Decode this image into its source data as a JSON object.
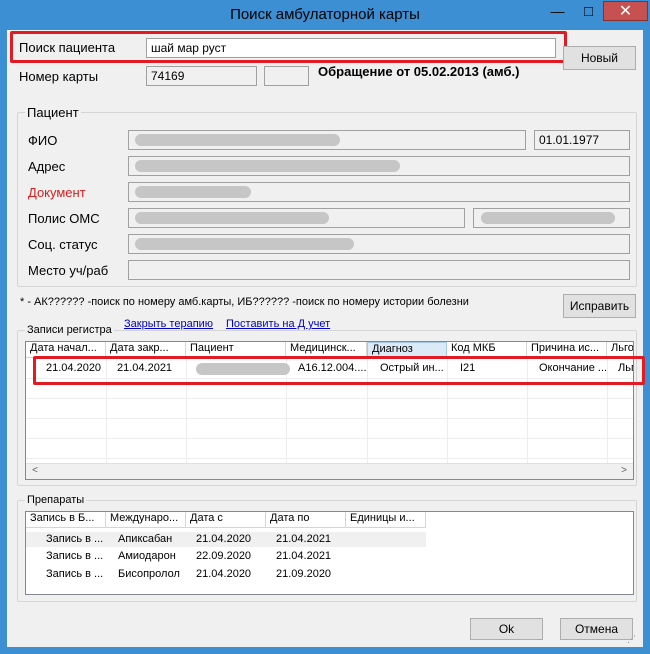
{
  "window": {
    "title": "Поиск амбулаторной карты",
    "minimize": "—",
    "maximize": "□",
    "close": "✕"
  },
  "search": {
    "label": "Поиск пациента",
    "value": "шай мар руст",
    "new_button": "Новый"
  },
  "card": {
    "label": "Номер карты",
    "number": "74169",
    "extra": "",
    "appeal": "Обращение от 05.02.2013 (амб.)"
  },
  "patient": {
    "group_title": "Пациент",
    "fio_label": "ФИО",
    "birth_date": "01.01.1977",
    "address_label": "Адрес",
    "document_label": "Документ",
    "document_color": "#d42020",
    "oms_label": "Полис ОМС",
    "social_label": "Соц. статус",
    "work_label": "Место уч/раб"
  },
  "hint": "* - АК?????? -поиск по номеру амб.карты, ИБ?????? -поиск по номеру истории болезни",
  "fix_button": "Исправить",
  "register": {
    "title": "Записи регистра",
    "link_close": "Закрыть терапию",
    "link_put": "Поставить на Д учет",
    "columns": [
      "Дата начал...",
      "Дата закр...",
      "Пациент",
      "Медицинск...",
      "Диагноз",
      "Код МКБ",
      "Причина ис...",
      "Льго"
    ],
    "row": {
      "start": "21.04.2020",
      "end": "21.04.2021",
      "patient": "",
      "med": "А16.12.004....",
      "diagnosis": "Острый ин...",
      "mkb": "I21",
      "reason": "Окончание ...",
      "benefit": "Льго"
    },
    "scroll_left": "<",
    "scroll_right": ">"
  },
  "drugs": {
    "title": "Препараты",
    "columns": [
      "Запись в Б...",
      "Междунаро...",
      "Дата с",
      "Дата по",
      "Единицы и..."
    ],
    "rows": [
      {
        "record": "Запись в ...",
        "name": "Апиксабан",
        "from": "21.04.2020",
        "to": "21.04.2021",
        "units": ""
      },
      {
        "record": "Запись в ...",
        "name": "Амиодарон",
        "from": "22.09.2020",
        "to": "21.04.2021",
        "units": ""
      },
      {
        "record": "Запись в ...",
        "name": "Бисопролол",
        "from": "21.04.2020",
        "to": "21.09.2020",
        "units": ""
      }
    ]
  },
  "footer": {
    "ok": "Ok",
    "cancel": "Отмена"
  }
}
